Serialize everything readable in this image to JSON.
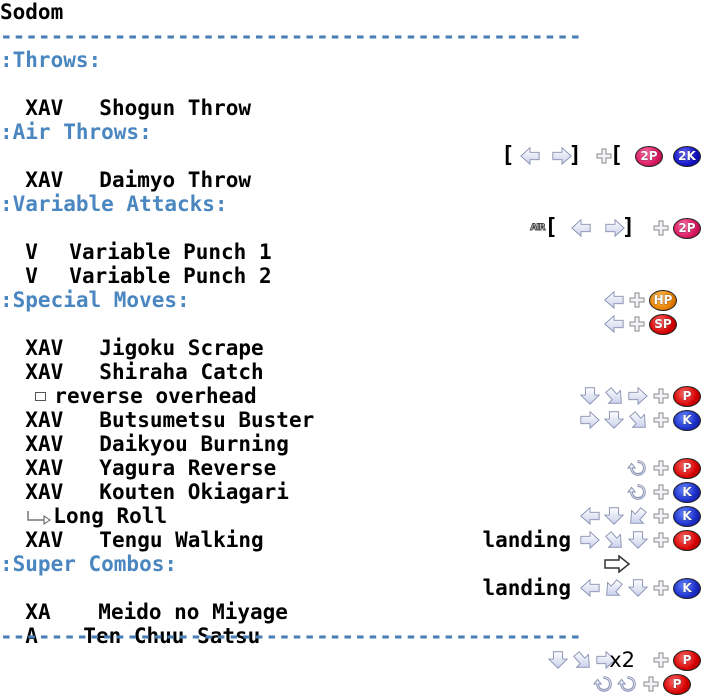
{
  "title": "Sodom",
  "separator": "----------------------------------------------",
  "colors": {
    "section": "#4a86c0",
    "separator": "#4a7fb5",
    "punch": "#d40000",
    "kick": "#1a2cc8",
    "hp": "#e88000",
    "2p": "#d81860"
  },
  "sections": {
    "throws": {
      "label": ":Throws:",
      "moves": [
        {
          "version": "XAV",
          "name": "Shogun Throw",
          "command": [
            "[",
            "left-arrow",
            "/",
            "right-arrow",
            "]",
            "plus",
            "[",
            "2P",
            "/",
            "2K",
            "]"
          ]
        }
      ]
    },
    "air_throws": {
      "label": ":Air Throws:",
      "moves": [
        {
          "version": "XAV",
          "name": "Daimyo Throw",
          "prefix": "AIR",
          "command": [
            "[",
            "left-arrow",
            "/",
            "right-arrow",
            "]",
            "plus",
            "2P"
          ]
        }
      ]
    },
    "variable_attacks": {
      "label": ":Variable Attacks:",
      "moves": [
        {
          "version": "V",
          "name": "Variable Punch 1",
          "command": [
            "left-arrow",
            "plus",
            "HP"
          ]
        },
        {
          "version": "V",
          "name": "Variable Punch 2",
          "command": [
            "left-arrow",
            "plus",
            "SP"
          ]
        }
      ]
    },
    "special_moves": {
      "label": ":Special Moves:",
      "moves": [
        {
          "version": "XAV",
          "name": "Jigoku Scrape",
          "command": [
            "down",
            "down-right",
            "right",
            "plus",
            "P"
          ]
        },
        {
          "version": "XAV",
          "name": "Shiraha Catch",
          "command": [
            "right",
            "down",
            "down-right",
            "plus",
            "K"
          ]
        },
        {
          "version": "",
          "name": "reverse overhead",
          "bullet": true
        },
        {
          "version": "XAV",
          "name": "Butsumetsu Buster",
          "command": [
            "360",
            "plus",
            "P"
          ]
        },
        {
          "version": "XAV",
          "name": "Daikyou Burning",
          "command": [
            "360",
            "plus",
            "K"
          ]
        },
        {
          "version": "XAV",
          "name": "Yagura Reverse",
          "command": [
            "left",
            "down",
            "down-left",
            "plus",
            "K"
          ]
        },
        {
          "version": "XAV",
          "name": "Kouten Okiagari",
          "note": "landing",
          "command": [
            "right",
            "down-right",
            "down",
            "plus",
            "P"
          ]
        },
        {
          "version": "",
          "name": "Long Roll",
          "follow_up": true,
          "command": [
            "right-outline"
          ]
        },
        {
          "version": "XAV",
          "name": "Tengu Walking",
          "note": "landing",
          "command": [
            "left",
            "down-left",
            "down",
            "plus",
            "K"
          ]
        }
      ]
    },
    "super_combos": {
      "label": ":Super Combos:",
      "moves": [
        {
          "version": "XA",
          "name": "Meido no Miyage",
          "command": [
            "down",
            "down-right",
            "right",
            "x2",
            "plus",
            "P"
          ],
          "repeat": "x2"
        },
        {
          "version": "A",
          "name": "Ten Chuu Satsu",
          "command": [
            "360",
            "360",
            "plus",
            "P"
          ]
        }
      ]
    }
  },
  "labels": {
    "air": "AIR",
    "x2": "x2",
    "p": "P",
    "k": "K",
    "hp": "HP",
    "sp": "SP",
    "p2": "2P",
    "k2": "2K",
    "open": "[",
    "close": "]"
  }
}
